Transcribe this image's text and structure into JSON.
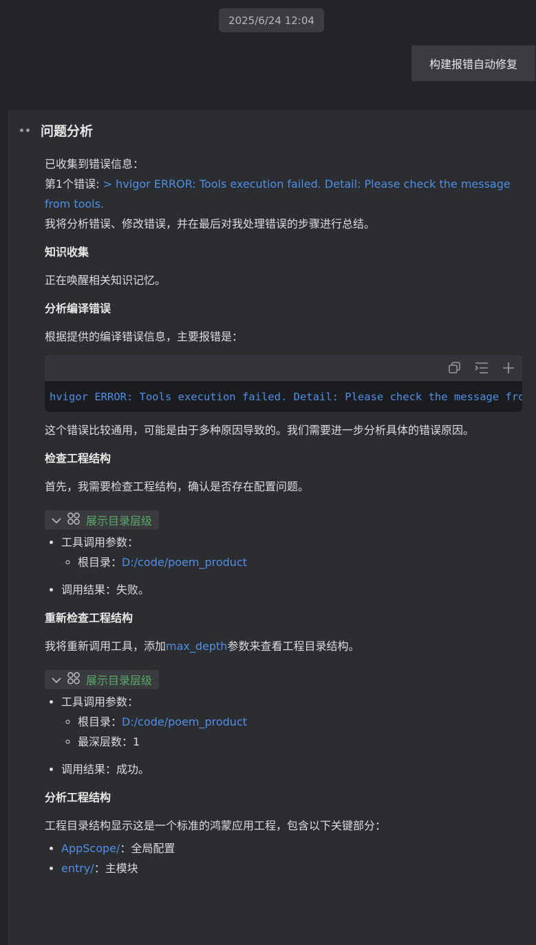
{
  "timestamp": "2025/6/24 12:04",
  "user_message": "构建报错自动修复",
  "panel": {
    "title": "问题分析",
    "intro_1": "已收集到错误信息：",
    "error_prefix": "第1个错误: ",
    "error_text": "> hvigor ERROR: Tools execution failed. Detail: Please check the message from tools.",
    "intro_2": "我将分析错误、修改错误，并在最后对我处理错误的步骤进行总结。",
    "s1_title": "知识收集",
    "s1_text": "正在唤醒相关知识记忆。",
    "s2_title": "分析编译错误",
    "s2_text": "根据提供的编译错误信息，主要报错是：",
    "code_line": "hvigor ERROR: Tools execution failed. Detail: Please check the message from tools.",
    "s2_after": "这个错误比较通用，可能是由于多种原因导致的。我们需要进一步分析具体的错误原因。",
    "s3_title": "检查工程结构",
    "s3_text": "首先，我需要检查工程结构，确认是否存在配置问题。",
    "tool1": {
      "label": "展示目录层级",
      "params_label": "工具调用参数：",
      "root_label": "根目录：",
      "root_value": "D:/code/poem_product",
      "result": "调用结果：失败。"
    },
    "s4_title": "重新检查工程结构",
    "s4_pre": "我将重新调用工具，添加",
    "s4_param": "max_depth",
    "s4_post": "参数来查看工程目录结构。",
    "tool2": {
      "label": "展示目录层级",
      "params_label": "工具调用参数：",
      "root_label": "根目录：",
      "root_value": "D:/code/poem_product",
      "depth_label": "最深层数：",
      "depth_value": "1",
      "result": "调用结果：成功。"
    },
    "s5_title": "分析工程结构",
    "s5_text": "工程目录结构显示这是一个标准的鸿蒙应用工程，包含以下关键部分：",
    "structure": [
      {
        "name": "AppScope/",
        "desc": "：全局配置"
      },
      {
        "name": "entry/",
        "desc": "：主模块"
      }
    ]
  },
  "icons": [
    "copy-icon",
    "wrap-lines-icon",
    "plus-icon",
    "chevron-down-icon",
    "grid-icon"
  ],
  "colors": {
    "link": "#4f8fe6",
    "tool_label": "#5aa86a",
    "panel_bg": "#2c2d31",
    "page_bg": "#232427"
  }
}
